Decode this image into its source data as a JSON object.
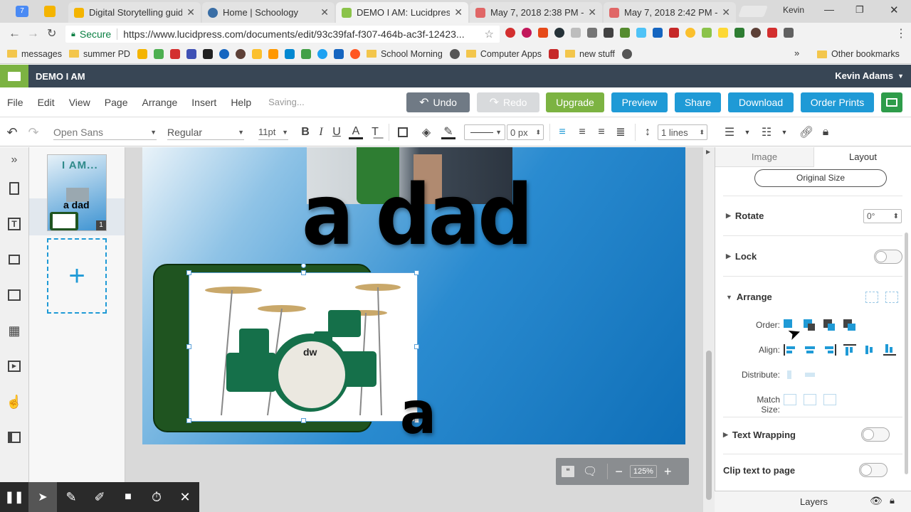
{
  "browser": {
    "tabs": [
      {
        "label": "Digital Storytelling guide",
        "color": "#f4b400"
      },
      {
        "label": "Home | Schoology",
        "color": "#3a6ea5"
      },
      {
        "label": "DEMO I AM: Lucidpress",
        "color": "#8bc34a"
      },
      {
        "label": "May 7, 2018 2:38 PM - S",
        "color": "#e06666"
      },
      {
        "label": "May 7, 2018 2:42 PM - S",
        "color": "#e06666"
      }
    ],
    "user": "Kevin",
    "secure_label": "Secure",
    "url": "https://www.lucidpress.com/documents/edit/93c39faf-f307-464b-ac3f-12423...",
    "bookmarks": [
      "messages",
      "summer PD",
      "School Morning",
      "Computer Apps",
      "new stuff"
    ],
    "more_bookmarks": "»",
    "other_bookmarks": "Other bookmarks"
  },
  "app": {
    "doc_title": "DEMO I AM",
    "user_name": "Kevin Adams",
    "menu": [
      "File",
      "Edit",
      "View",
      "Page",
      "Arrange",
      "Insert",
      "Help"
    ],
    "status": "Saving...",
    "buttons": {
      "undo": "Undo",
      "redo": "Redo",
      "upgrade": "Upgrade",
      "preview": "Preview",
      "share": "Share",
      "download": "Download",
      "order_prints": "Order Prints"
    }
  },
  "format": {
    "font": "Open Sans",
    "weight": "Regular",
    "size": "11pt",
    "stroke_width": "0 px",
    "line_spacing": "1 lines"
  },
  "pages": {
    "thumb_title": "I AM...",
    "thumb_sub": "a dad",
    "page_number": "1",
    "add_icon": "+"
  },
  "slide": {
    "text_dad": "a dad",
    "text_drummer": "a drummer",
    "drum_logo": "dw"
  },
  "zoom": {
    "level": "125%",
    "minus": "−",
    "plus": "+"
  },
  "panel": {
    "tabs": [
      "Image",
      "Layout"
    ],
    "original_size": "Original Size",
    "rotate_label": "Rotate",
    "rotate_value": "0°",
    "lock_label": "Lock",
    "arrange_label": "Arrange",
    "order_label": "Order:",
    "align_label": "Align:",
    "distribute_label": "Distribute:",
    "match_size_label": "Match Size:",
    "text_wrapping_label": "Text Wrapping",
    "clip_label": "Clip text to page",
    "layers_label": "Layers"
  },
  "colors": {
    "accent": "#1f9ad6",
    "green": "#7cb342",
    "slide_dark_green": "#1f5420",
    "header": "#384655"
  }
}
